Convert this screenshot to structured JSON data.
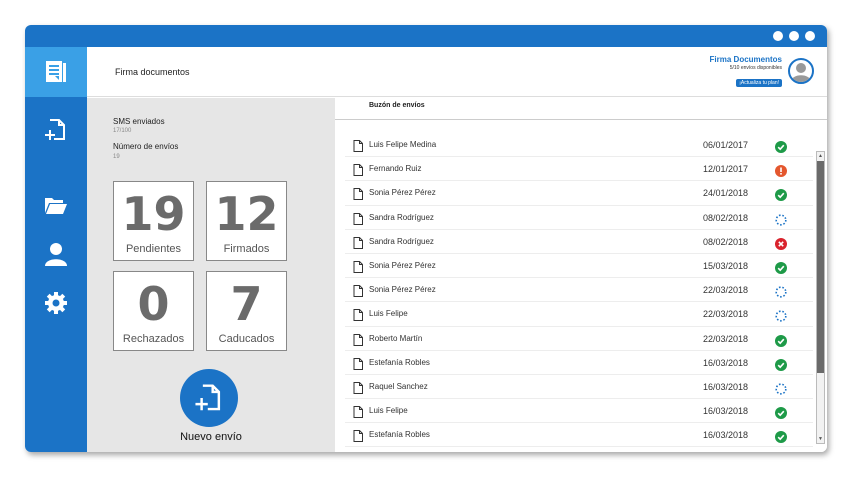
{
  "header": {
    "title": "Firma documentos",
    "user_name": "Firma Documentos",
    "user_sub": "5/10 envíos disponibles",
    "plan_link": "¡Actualiza tu plan!"
  },
  "sidebar": {
    "items": [
      {
        "name": "documents",
        "icon": "document-list-icon",
        "active": true
      },
      {
        "name": "new-document",
        "icon": "add-document-icon"
      },
      {
        "name": "folder",
        "icon": "folder-icon"
      },
      {
        "name": "user",
        "icon": "user-icon"
      },
      {
        "name": "settings",
        "icon": "gear-icon"
      }
    ]
  },
  "stats": {
    "sms_label": "SMS enviados",
    "sms_value": "17/100",
    "envios_label": "Número de envíos",
    "envios_value": "19",
    "cards": [
      {
        "number": "19",
        "label": "Pendientes"
      },
      {
        "number": "12",
        "label": "Firmados"
      },
      {
        "number": "0",
        "label": "Rechazados"
      },
      {
        "number": "7",
        "label": "Caducados"
      }
    ],
    "new_button_label": "Nuevo envío"
  },
  "inbox": {
    "title": "Buzón de envíos",
    "rows": [
      {
        "name": "Luis Felipe Medina",
        "date": "06/01/2017",
        "status": "signed"
      },
      {
        "name": "Fernando Ruiz",
        "date": "12/01/2017",
        "status": "warning"
      },
      {
        "name": "Sonia Pérez Pérez",
        "date": "24/01/2018",
        "status": "signed"
      },
      {
        "name": "Sandra Rodríguez",
        "date": "08/02/2018",
        "status": "pending"
      },
      {
        "name": "Sandra Rodríguez",
        "date": "08/02/2018",
        "status": "rejected"
      },
      {
        "name": "Sonia Pérez Pérez",
        "date": "15/03/2018",
        "status": "signed"
      },
      {
        "name": "Sonia Pérez Pérez",
        "date": "22/03/2018",
        "status": "pending"
      },
      {
        "name": "Luis Felipe",
        "date": "22/03/2018",
        "status": "pending"
      },
      {
        "name": "Roberto Martín",
        "date": "22/03/2018",
        "status": "signed"
      },
      {
        "name": "Estefanía Robles",
        "date": "16/03/2018",
        "status": "signed"
      },
      {
        "name": "Raquel Sanchez",
        "date": "16/03/2018",
        "status": "pending"
      },
      {
        "name": "Luis Felipe",
        "date": "16/03/2018",
        "status": "signed"
      },
      {
        "name": "Estefanía Robles",
        "date": "16/03/2018",
        "status": "signed"
      }
    ]
  },
  "colors": {
    "brand": "#1b73c6",
    "active": "#3aa0e6",
    "signed": "#1e9a48",
    "warning": "#e4572e",
    "rejected": "#d9232d",
    "pending": "#1b73c6"
  }
}
